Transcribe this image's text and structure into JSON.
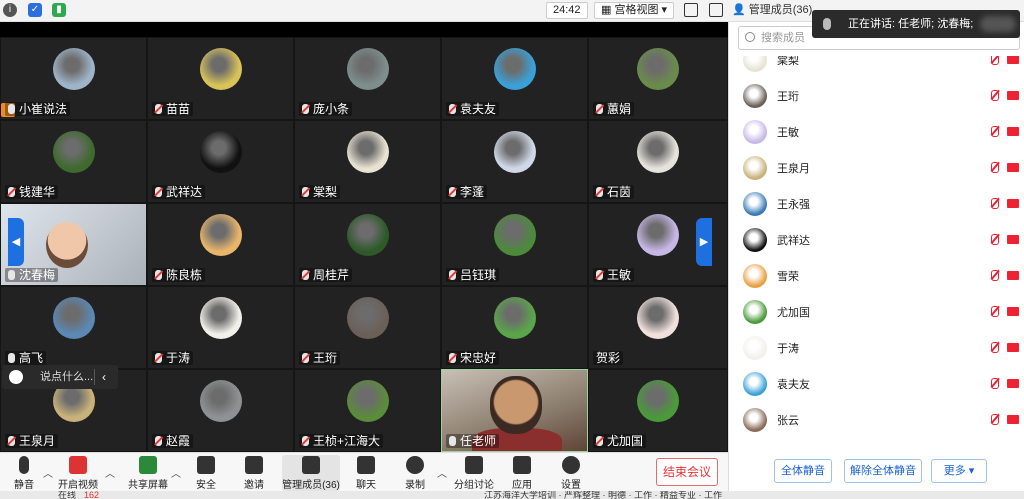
{
  "topbar": {
    "timer": "24:42",
    "view_label": "宫格视图",
    "members_title": "管理成员(36)"
  },
  "speaking": {
    "text": "正在讲话: 任老师; 沈春梅;"
  },
  "tiles": [
    {
      "name": "小崔说法",
      "mic": "on",
      "color": "#9fb4c9"
    },
    {
      "name": "苗苗",
      "mic": "off",
      "color": "#d8c25a"
    },
    {
      "name": "庞小条",
      "mic": "off",
      "color": "#7d8e8c"
    },
    {
      "name": "袁夫友",
      "mic": "off",
      "color": "#3aa0d8"
    },
    {
      "name": "蕙娟",
      "mic": "off",
      "color": "#6a8c4a"
    },
    {
      "name": "钱建华",
      "mic": "off",
      "color": "#3f6a2e"
    },
    {
      "name": "武祥达",
      "mic": "off",
      "color": "#111111"
    },
    {
      "name": "棠梨",
      "mic": "off",
      "color": "#e8e2d2"
    },
    {
      "name": "李蓬",
      "mic": "off",
      "color": "#d0d8e8"
    },
    {
      "name": "石茵",
      "mic": "off",
      "color": "#e6e3dc"
    },
    {
      "name": "沈春梅",
      "mic": "on",
      "color": "#cfd6dd"
    },
    {
      "name": "陈良栋",
      "mic": "off",
      "color": "#e8b56b"
    },
    {
      "name": "周桂芹",
      "mic": "off",
      "color": "#2e5a2a"
    },
    {
      "name": "吕钰琪",
      "mic": "off",
      "color": "#4c8a3c"
    },
    {
      "name": "王敏",
      "mic": "off",
      "color": "#c7b7e6"
    },
    {
      "name": "高飞",
      "mic": "on",
      "color": "#5b88b4"
    },
    {
      "name": "于涛",
      "mic": "off",
      "color": "#f2f0ea"
    },
    {
      "name": "王珩",
      "mic": "off",
      "color": "#6b6058"
    },
    {
      "name": "宋忠好",
      "mic": "off",
      "color": "#5aa54a"
    },
    {
      "name": "贺彩",
      "mic": "none",
      "color": "#f1e1dc"
    },
    {
      "name": "王泉月",
      "mic": "off",
      "color": "#c9b27a"
    },
    {
      "name": "赵霞",
      "mic": "off",
      "color": "#8f9294"
    },
    {
      "name": "王桢+江海大",
      "mic": "off",
      "color": "#5a8c3a"
    },
    {
      "name": "任老师",
      "mic": "on",
      "color": "#a06050"
    },
    {
      "name": "尤加国",
      "mic": "off",
      "color": "#4a9a3a"
    }
  ],
  "chat": {
    "placeholder": "说点什么..."
  },
  "toolbar": {
    "mute": "静音",
    "video": "开启视频",
    "share": "共享屏幕",
    "security": "安全",
    "invite": "邀请",
    "members": "管理成员(36)",
    "chat": "聊天",
    "record": "录制",
    "breakout": "分组讨论",
    "apps": "应用",
    "settings": "设置",
    "end": "结束会议"
  },
  "panel": {
    "search_placeholder": "搜索成员",
    "members": [
      {
        "name": "棠梨",
        "color": "#e8e2d2"
      },
      {
        "name": "王珩",
        "color": "#6b6058"
      },
      {
        "name": "王敏",
        "color": "#c7b7e6"
      },
      {
        "name": "王泉月",
        "color": "#c9b27a"
      },
      {
        "name": "王永强",
        "color": "#3a7ab8"
      },
      {
        "name": "武祥达",
        "color": "#111111"
      },
      {
        "name": "雪荣",
        "color": "#e8a040"
      },
      {
        "name": "尤加国",
        "color": "#4a9a3a"
      },
      {
        "name": "于涛",
        "color": "#f2f0ea"
      },
      {
        "name": "袁夫友",
        "color": "#3aa0d8"
      },
      {
        "name": "张云",
        "color": "#8a6a5a"
      }
    ],
    "mute_all": "全体静音",
    "unmute_all": "解除全体静音",
    "more": "更多 ▾"
  },
  "status": {
    "online_label": "在线",
    "online_count": "162",
    "notice": "江苏海洋大学培训 · 严辉整理 · 明德 · 工作 · 精益专业 · 工作"
  }
}
